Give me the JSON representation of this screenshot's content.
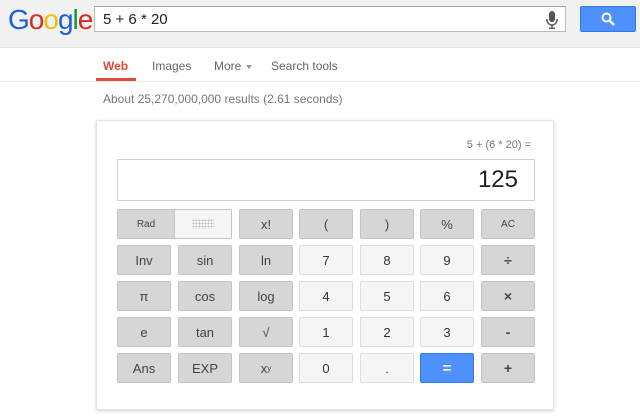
{
  "logo": {
    "letters": [
      "G",
      "o",
      "o",
      "g",
      "l",
      "e"
    ],
    "colors": [
      "#1a5fd6",
      "#d62d20",
      "#eebf00",
      "#1a5fd6",
      "#0c9d32",
      "#d62d20"
    ]
  },
  "search": {
    "query": "5 + 6 * 20",
    "mic_icon": "microphone-icon",
    "button_icon": "magnifier-icon"
  },
  "nav": {
    "items": [
      {
        "label": "Web",
        "active": true
      },
      {
        "label": "Images",
        "active": false
      },
      {
        "label": "More",
        "active": false
      },
      {
        "label": "Search tools",
        "active": false
      }
    ]
  },
  "results": {
    "count_text": "About 25,270,000,000 results (2.61 seconds)"
  },
  "calculator": {
    "expression": "5 + (6 * 20) =",
    "display": "125",
    "mode": {
      "rad_label": "Rad"
    },
    "keys": {
      "factorial": "x!",
      "lparen": "(",
      "rparen": ")",
      "percent": "%",
      "ac": "AC",
      "inv": "Inv",
      "sin": "sin",
      "ln": "ln",
      "seven": "7",
      "eight": "8",
      "nine": "9",
      "divide": "÷",
      "pi": "π",
      "cos": "cos",
      "log": "log",
      "four": "4",
      "five": "5",
      "six": "6",
      "multiply": "×",
      "e": "e",
      "tan": "tan",
      "sqrt": "√",
      "one": "1",
      "two": "2",
      "three": "3",
      "minus": "-",
      "ans": "Ans",
      "exp": "EXP",
      "power_base": "x",
      "power_exp": "y",
      "zero": "0",
      "dot": ".",
      "equals": "=",
      "plus": "+"
    }
  },
  "colors": {
    "accent_blue": "#4d90fe",
    "active_red": "#dd4b39"
  }
}
